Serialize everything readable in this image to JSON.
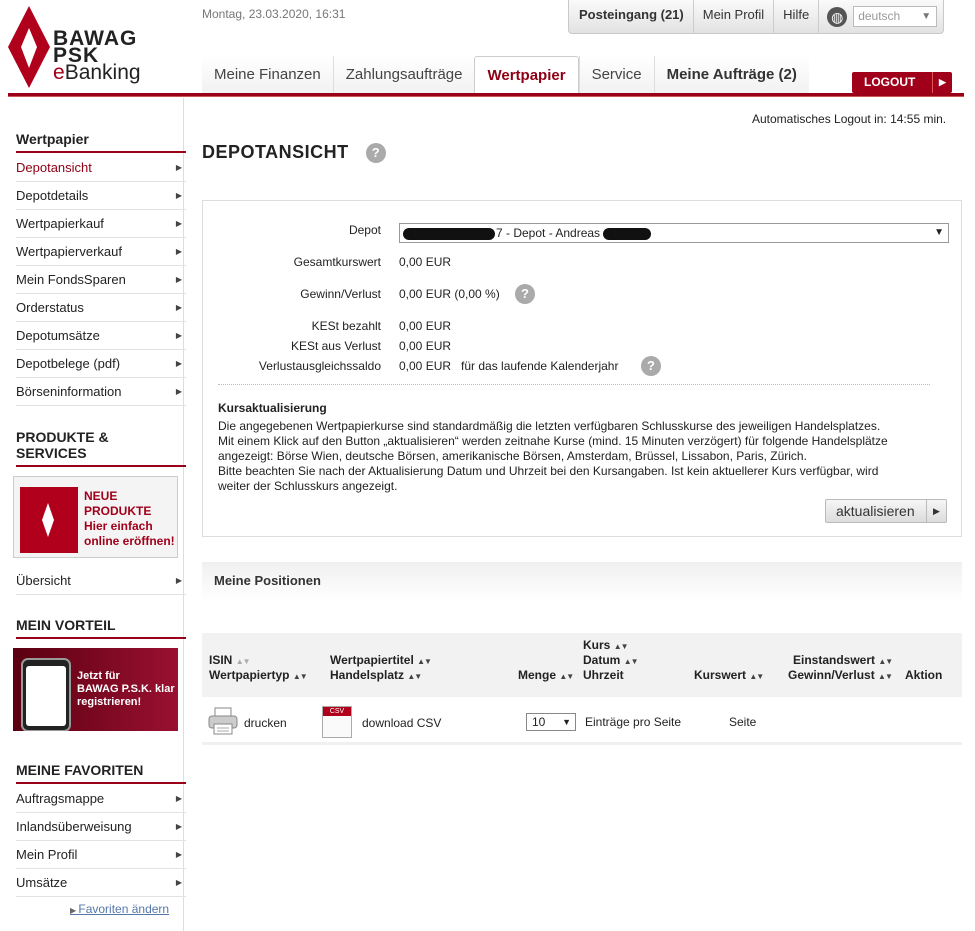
{
  "header": {
    "logo_line1": "BAWAG",
    "logo_line2": "PSK",
    "logo_line3_e": "e",
    "logo_line3_rest": "Banking",
    "datetime": "Montag, 23.03.2020, 16:31",
    "inbox": "Posteingang (21)",
    "profile": "Mein Profil",
    "help": "Hilfe",
    "language": "deutsch",
    "logout": "LOGOUT",
    "tabs": [
      "Meine Finanzen",
      "Zahlungsaufträge",
      "Wertpapier",
      "Service",
      "Meine Aufträge (2)"
    ]
  },
  "sidebar": {
    "section1": "Wertpapier",
    "items1": [
      "Depotansicht",
      "Depotdetails",
      "Wertpapierkauf",
      "Wertpapierverkauf",
      "Mein FondsSparen",
      "Orderstatus",
      "Depotumsätze",
      "Depotbelege (pdf)",
      "Börseninformation"
    ],
    "section2_l1": "PRODUKTE &",
    "section2_l2": "SERVICES",
    "promo1_l1": "NEUE",
    "promo1_l2": "PRODUKTE",
    "promo1_l3": "Hier einfach",
    "promo1_l4": "online eröffnen!",
    "overview": "Übersicht",
    "section3": "MEIN VORTEIL",
    "promo2_l1": "Jetzt für",
    "promo2_l2": "BAWAG P.S.K. klar",
    "promo2_l3": "registrieren!",
    "section4": "MEINE FAVORITEN",
    "favorites": [
      "Auftragsmappe",
      "Inlandsüberweisung",
      "Mein Profil",
      "Umsätze"
    ],
    "favorites_change": "Favoriten ändern"
  },
  "main": {
    "autologout": "Automatisches Logout in: 14:55  min.",
    "title": "DEPOTANSICHT",
    "help_glyph": "?",
    "depot_label": "Depot",
    "depot_value_a": "7 - Depot - Andreas ",
    "summary": [
      {
        "label": "Gesamtkurswert",
        "value": "0,00 EUR"
      },
      {
        "label": "Gewinn/Verlust",
        "value": "0,00 EUR (0,00 %)"
      },
      {
        "label": "KESt bezahlt",
        "value": "0,00 EUR"
      },
      {
        "label": "KESt aus Verlust",
        "value": "0,00 EUR"
      },
      {
        "label": "Verlustausgleichssaldo",
        "value": "0,00 EUR   für das laufende Kalenderjahr"
      }
    ],
    "kurs_heading": "Kursaktualisierung",
    "kurs_text1": "Die angegebenen Wertpapierkurse sind standardmäßig die letzten verfügbaren Schlusskurse des jeweiligen Handelsplatzes.",
    "kurs_text2": "Mit einem Klick auf den Button „aktualisieren“ werden zeitnahe Kurse (mind. 15 Minuten verzögert) für folgende Handelsplätze",
    "kurs_text3": "angezeigt: Börse Wien, deutsche Börsen, amerikanische Börsen, Amsterdam, Brüssel, Lissabon, Paris, Zürich.",
    "kurs_text4": "Bitte beachten Sie nach der Aktualisierung Datum und Uhrzeit bei den Kursangaben. Ist kein aktuellerer Kurs verfügbar, wird",
    "kurs_text5": "weiter der Schlusskurs angezeigt.",
    "refresh_button": "aktualisieren",
    "positions_title": "Meine Positionen",
    "columns": {
      "isin": "ISIN",
      "type": "Wertpapiertyp",
      "title": "Wertpapiertitel",
      "place": "Handelsplatz",
      "qty": "Menge",
      "rate": "Kurs",
      "date": "Datum",
      "time": "Uhrzeit",
      "value": "Kurswert",
      "invest": "Einstandswert",
      "gain": "Gewinn/Verlust",
      "action": "Aktion"
    },
    "print": "drucken",
    "csv": "download CSV",
    "csv_badge": "CSV",
    "per_page_value": "10",
    "per_page_label": "Einträge pro Seite",
    "page_label": "Seite"
  }
}
